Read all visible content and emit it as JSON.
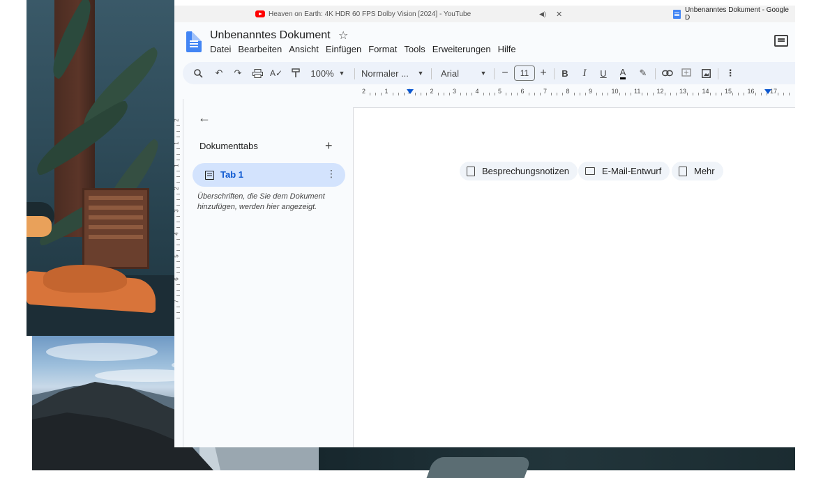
{
  "browser": {
    "tabs": [
      {
        "title": "Heaven on Earth: 4K HDR 60 FPS Dolby Vision [2024] - YouTube",
        "audio_icon": "speaker-icon",
        "close_icon": "close-icon"
      },
      {
        "title": "Unbenanntes Dokument - Google D"
      }
    ]
  },
  "docs": {
    "title": "Unbenanntes Dokument",
    "menu": [
      "Datei",
      "Bearbeiten",
      "Ansicht",
      "Einfügen",
      "Format",
      "Tools",
      "Erweiterungen",
      "Hilfe"
    ],
    "toolbar": {
      "zoom": "100%",
      "style": "Normaler ...",
      "font": "Arial",
      "font_size": "11",
      "minus": "−",
      "plus": "+",
      "bold": "B",
      "italic": "I",
      "underline": "U",
      "text_color": "A"
    },
    "ruler_numbers": [
      "2",
      "1",
      "1",
      "2",
      "3",
      "4",
      "5",
      "6",
      "7",
      "8",
      "9",
      "10",
      "11",
      "12",
      "13",
      "14",
      "15",
      "16",
      "17"
    ],
    "vruler_numbers": [
      "2",
      "1",
      "1",
      "2",
      "3",
      "4",
      "5",
      "6",
      "7"
    ],
    "sidebar": {
      "heading": "Dokumenttabs",
      "add": "+",
      "tab_label": "Tab 1",
      "hint": "Überschriften, die Sie dem Dokument hinzufügen, werden hier angezeigt."
    },
    "chips": [
      "Besprechungsnotizen",
      "E-Mail-Entwurf",
      "Mehr"
    ]
  },
  "colors": {
    "accent": "#0b57d0",
    "tab_highlight": "#d3e3fd",
    "toolbar_bg": "#edf2fa",
    "youtube_red": "#ff0000",
    "docs_blue": "#4285f4"
  }
}
